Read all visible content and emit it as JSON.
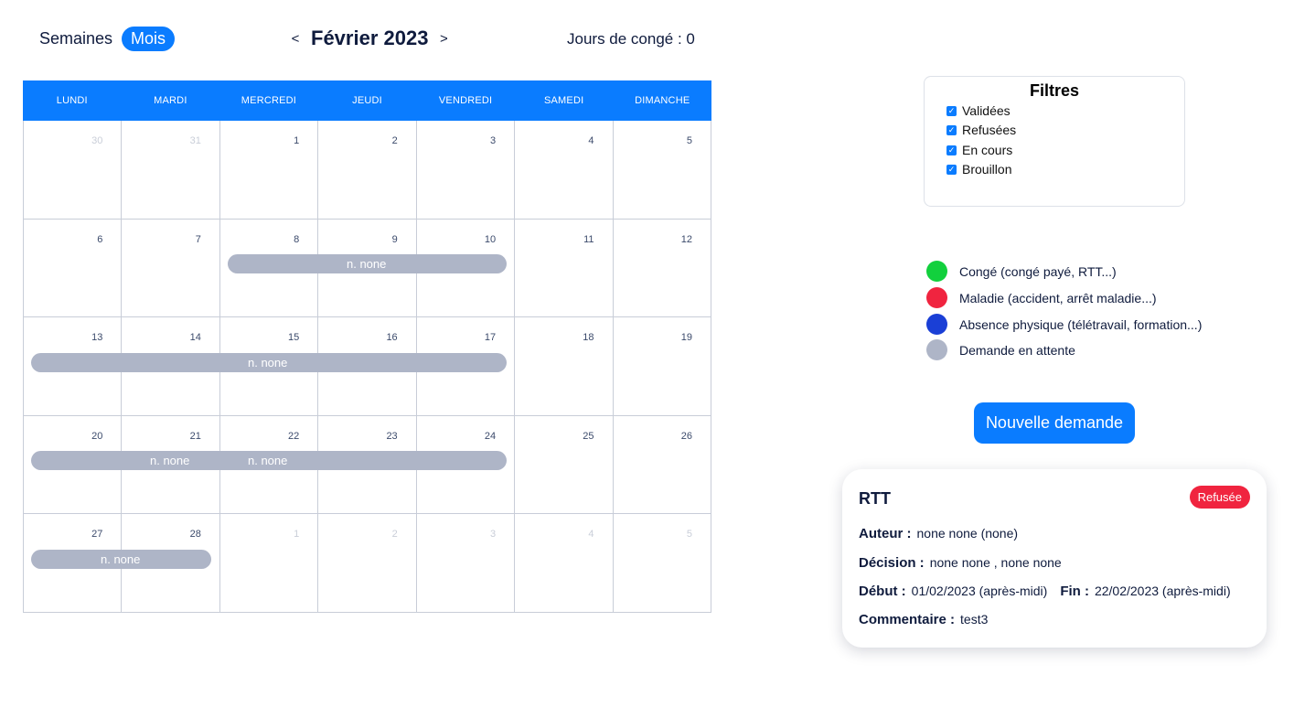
{
  "view": {
    "weeks_label": "Semaines",
    "month_label": "Mois"
  },
  "nav": {
    "prev": "<",
    "next": ">",
    "title": "Février 2023"
  },
  "leave_days": "Jours de congé : 0",
  "calendar": {
    "days": [
      "LUNDI",
      "MARDI",
      "MERCREDI",
      "JEUDI",
      "VENDREDI",
      "SAMEDI",
      "DIMANCHE"
    ],
    "weeks": [
      [
        "30",
        "31",
        "1",
        "2",
        "3",
        "4",
        "5"
      ],
      [
        "6",
        "7",
        "8",
        "9",
        "10",
        "11",
        "12"
      ],
      [
        "13",
        "14",
        "15",
        "16",
        "17",
        "18",
        "19"
      ],
      [
        "20",
        "21",
        "22",
        "23",
        "24",
        "25",
        "26"
      ],
      [
        "27",
        "28",
        "1",
        "2",
        "3",
        "4",
        "5"
      ]
    ],
    "event_label": "n. none"
  },
  "filters": {
    "title": "Filtres",
    "items": [
      "Validées",
      "Refusées",
      "En cours",
      "Brouillon"
    ]
  },
  "legend": [
    {
      "label": "Congé (congé payé, RTT...)",
      "color": "#12d03d"
    },
    {
      "label": "Maladie (accident, arrêt maladie...)",
      "color": "#f0243f"
    },
    {
      "label": "Absence physique (télétravail, formation...)",
      "color": "#1a3fd6"
    },
    {
      "label": "Demande en attente",
      "color": "#aeb5c7"
    }
  ],
  "new_request_label": "Nouvelle demande",
  "detail": {
    "title": "RTT",
    "status": "Refusée",
    "author_label": "Auteur :",
    "author_value": "none none (none)",
    "decision_label": "Décision :",
    "decision_value": "none none , none none",
    "start_label": "Début :",
    "start_value": "01/02/2023 (après-midi)",
    "end_label": "Fin :",
    "end_value": "22/02/2023 (après-midi)",
    "comment_label": "Commentaire :",
    "comment_value": "test3"
  },
  "colors": {
    "accent": "#0a7cff",
    "pending": "#aeb5c7",
    "refused": "#f0243f"
  }
}
